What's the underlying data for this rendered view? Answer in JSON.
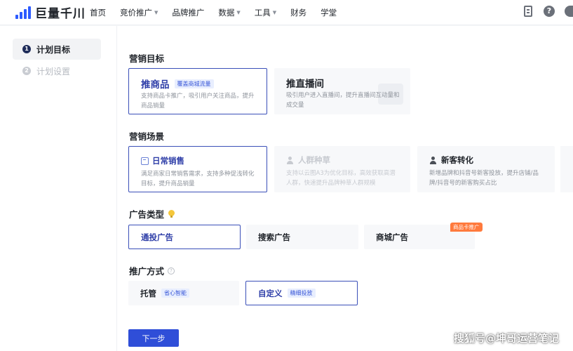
{
  "brand": {
    "logo_text": "巨量千川"
  },
  "nav": [
    {
      "label": "首页",
      "caret": false
    },
    {
      "label": "竞价推广",
      "caret": true
    },
    {
      "label": "品牌推广",
      "caret": false
    },
    {
      "label": "数据",
      "caret": true
    },
    {
      "label": "工具",
      "caret": true
    },
    {
      "label": "财务",
      "caret": false
    },
    {
      "label": "学堂",
      "caret": false
    }
  ],
  "header_icons": [
    "document-icon",
    "help-icon",
    "avatar-icon"
  ],
  "help_glyph": "?",
  "steps": [
    {
      "num": "1",
      "label": "计划目标",
      "active": true
    },
    {
      "num": "2",
      "label": "计划设置",
      "active": false
    }
  ],
  "marketing_goal": {
    "title": "营销目标",
    "options": [
      {
        "title": "推商品",
        "tag": "覆盖商城流量",
        "desc": "支持商品卡推广，吸引用户关注商品，提升商品销量",
        "selected": true
      },
      {
        "title": "推直播间",
        "desc": "吸引用户进入直播间，提升直播间互动量和成交量",
        "selected": false
      }
    ]
  },
  "marketing_scene": {
    "title": "营销场景",
    "options": [
      {
        "title": "日常销售",
        "desc": "满足商家日常销售需求，支持多种促浅转化目标，提升商品销量",
        "selected": true,
        "disabled": false
      },
      {
        "title": "人群种草",
        "desc": "支持以云图A3为优化目标，高效获取高潜人群，快速提升品牌种草人群规模",
        "selected": false,
        "disabled": true
      },
      {
        "title": "新客转化",
        "desc": "新增品牌和抖音号新客投放，提升店铺/品牌/抖音号的新客购买占比",
        "selected": false,
        "disabled": false
      }
    ]
  },
  "ad_type": {
    "title": "广告类型",
    "options": [
      {
        "label": "通投广告",
        "selected": true
      },
      {
        "label": "搜索广告",
        "selected": false
      },
      {
        "label": "商城广告",
        "selected": false,
        "badge": "商品卡推广"
      }
    ]
  },
  "promo_method": {
    "title": "推广方式",
    "help": "?",
    "options": [
      {
        "label": "托管",
        "tag": "省心智能",
        "selected": false
      },
      {
        "label": "自定义",
        "tag": "精细投放",
        "selected": true
      }
    ]
  },
  "next_button": "下一步",
  "watermark": "搜狐号@坤哥运营笔记",
  "colors": {
    "primary": "#2f4ed8",
    "selected_border": "#3a4fb8",
    "badge": "#ff7a3d",
    "tag_text": "#3a58d8"
  }
}
